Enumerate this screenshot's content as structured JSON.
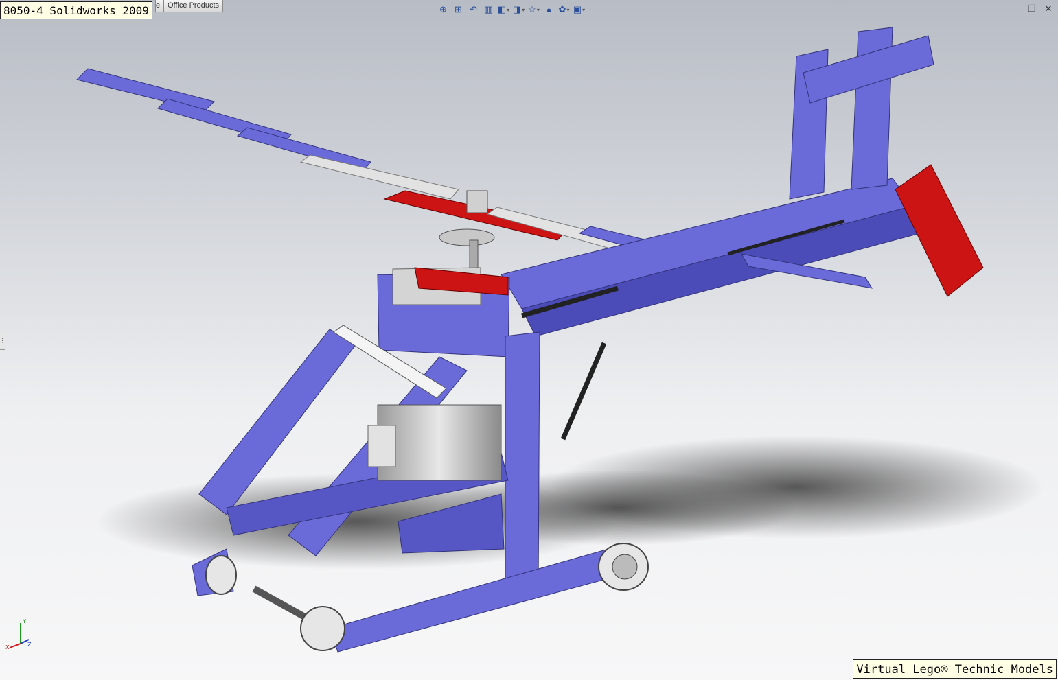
{
  "window": {
    "title_label": "8050-4 Solidworks 2009",
    "tabs": [
      {
        "label": "e"
      },
      {
        "label": "Office Products"
      }
    ]
  },
  "heads_up_toolbar": [
    {
      "icon": "zoom-to-fit-icon",
      "glyph": "⊕"
    },
    {
      "icon": "zoom-to-area-icon",
      "glyph": "⊞"
    },
    {
      "icon": "previous-view-icon",
      "glyph": "↶"
    },
    {
      "icon": "section-view-icon",
      "glyph": "▥"
    },
    {
      "icon": "view-orientation-icon",
      "glyph": "◧",
      "dropdown": "▾"
    },
    {
      "icon": "display-style-icon",
      "glyph": "◨",
      "dropdown": "▾"
    },
    {
      "icon": "hide-show-items-icon",
      "glyph": "☆",
      "dropdown": "▾"
    },
    {
      "icon": "edit-appearance-icon",
      "glyph": "●"
    },
    {
      "icon": "apply-scene-icon",
      "glyph": "✿",
      "dropdown": "▾"
    },
    {
      "icon": "view-settings-icon",
      "glyph": "▣",
      "dropdown": "▾"
    }
  ],
  "window_controls": {
    "minimize": "–",
    "restore": "❐",
    "close": "✕"
  },
  "side_handle_glyph": "⋮",
  "triad": {
    "x": "X",
    "y": "Y",
    "z": "Z"
  },
  "watermark": "Virtual Lego® Technic Models",
  "colors": {
    "beam_blue": "#6a6ad8",
    "beam_blue_dark": "#4444a8",
    "brick_red": "#cc1414",
    "light_gray": "#d8d8d8",
    "shaft_black": "#222222"
  }
}
